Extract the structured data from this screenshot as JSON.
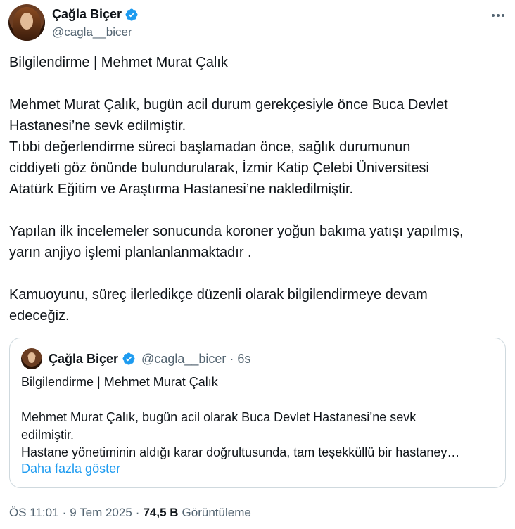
{
  "author": {
    "name": "Çağla Biçer",
    "handle": "@cagla__bicer"
  },
  "tweet": {
    "title": "Bilgilendirme | Mehmet Murat Çalık",
    "line1": "Mehmet Murat Çalık, bugün acil durum gerekçesiyle önce Buca Devlet",
    "line2": "Hastanesi’ne sevk edilmiştir.",
    "line3": "Tıbbi değerlendirme süreci başlamadan önce, sağlık durumunun",
    "line4": "ciddiyeti göz önünde bulundurularak, İzmir Katip Çelebi Üniversitesi",
    "line5": "Atatürk Eğitim ve Araştırma Hastanesi’ne nakledilmiştir.",
    "line6": "Yapılan ilk incelemeler sonucunda koroner yoğun bakıma yatışı yapılmış,",
    "line7": "yarın anjiyo işlemi planlanlanmaktadır .",
    "line8": "Kamuoyunu, süreç ilerledikçe düzenli olarak bilgilendirmeye devam",
    "line9": "edeceğiz."
  },
  "quote": {
    "name": "Çağla Biçer",
    "handle_time": "@cagla__bicer · 6s",
    "title": "Bilgilendirme | Mehmet Murat Çalık",
    "line1": "Mehmet Murat Çalık, bugün acil olarak Buca Devlet Hastanesi’ne sevk",
    "line2": "edilmiştir.",
    "line3": "Hastane yönetiminin aldığı karar doğrultusunda, tam teşekküllü bir hastaney…",
    "show_more": "Daha fazla göster"
  },
  "meta": {
    "time": "ÖS 11:01",
    "dot1": "·",
    "date": "9 Tem 2025",
    "dot2": "·",
    "views_count": "74,5 B",
    "views_label": "Görüntüleme"
  },
  "colors": {
    "verified": "#1d9bf0",
    "link": "#1d9bf0",
    "secondary_text": "#536471"
  },
  "icons": {
    "verified": "verified-badge-icon",
    "more": "more-options-icon"
  }
}
